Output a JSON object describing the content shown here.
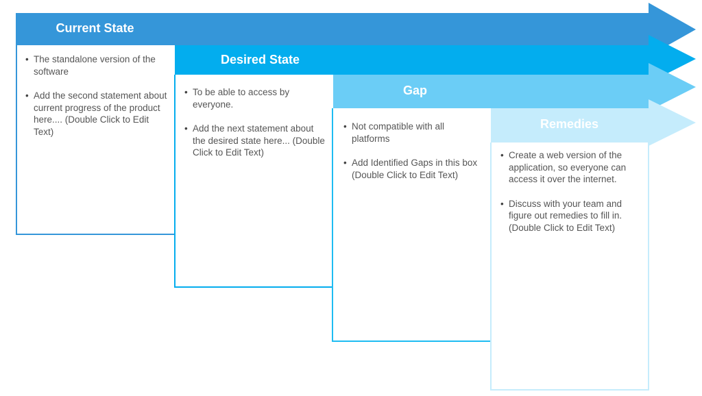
{
  "stages": [
    {
      "title": "Current State",
      "color": "#3596d9",
      "items": [
        "The standalone version of the software",
        "Add the second statement about current progress of the product here.... (Double Click to Edit Text)"
      ]
    },
    {
      "title": "Desired State",
      "color": "#03adee",
      "items": [
        "To be able to access by everyone.",
        "Add the next statement about the desired state here...       (Double Click to Edit Text)"
      ]
    },
    {
      "title": "Gap",
      "color": "#6bcdf6",
      "items": [
        "Not compatible with all platforms",
        "Add Identified Gaps in this box (Double Click to Edit Text)"
      ]
    },
    {
      "title": "Remedies",
      "color": "#c5ecfc",
      "items": [
        "Create a web version of the application, so everyone  can access it over the internet.",
        "Discuss with your team and figure out  remedies to fill in. (Double Click to Edit Text)"
      ]
    }
  ]
}
